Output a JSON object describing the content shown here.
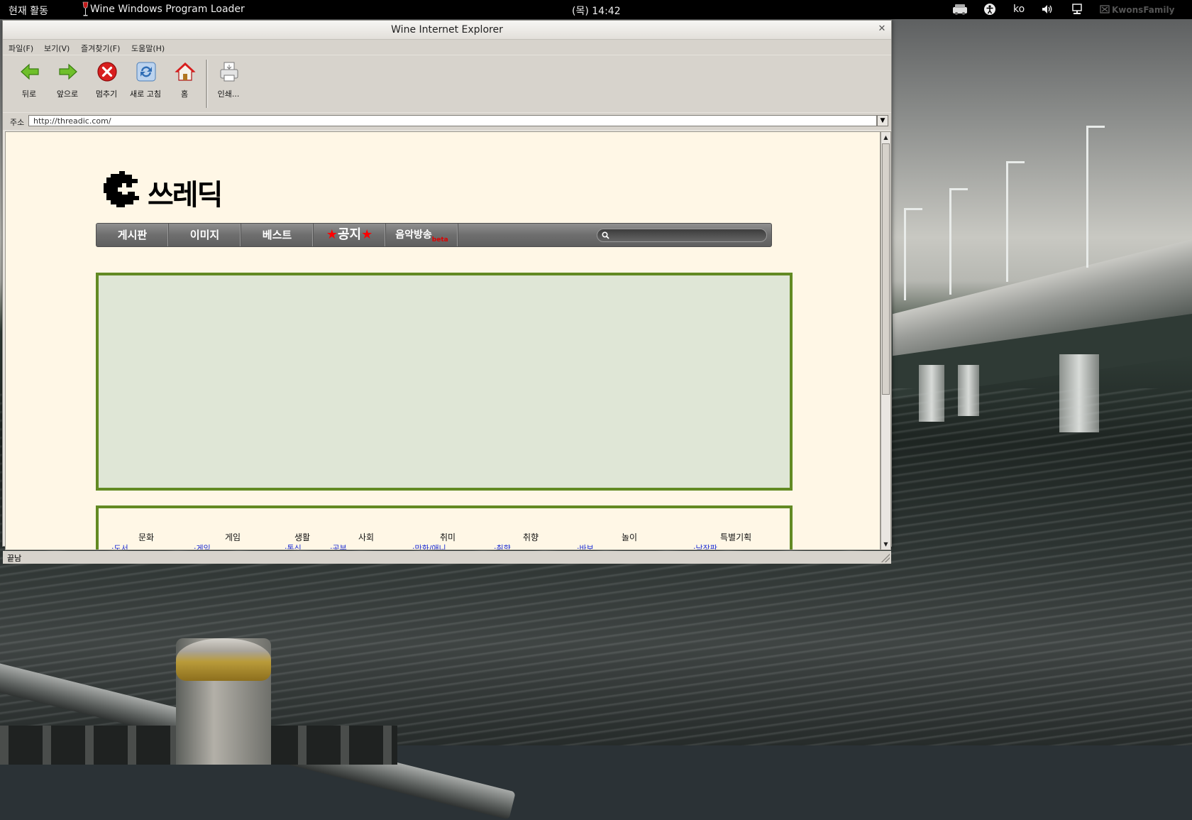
{
  "panel": {
    "activities": "현재 활동",
    "app_name": "Wine Windows Program Loader",
    "clock": "(목) 14:42",
    "lang": "ko",
    "user": "KwonsFamily"
  },
  "window": {
    "title": "Wine Internet Explorer",
    "close_glyph": "✕"
  },
  "menu": {
    "items": [
      "파일(F)",
      "보기(V)",
      "즐겨찾기(F)",
      "도움말(H)"
    ]
  },
  "toolbar": {
    "buttons": [
      {
        "label": "뒤로",
        "icon": "back-arrow-icon"
      },
      {
        "label": "앞으로",
        "icon": "forward-arrow-icon"
      },
      {
        "label": "멈추기",
        "icon": "stop-icon"
      },
      {
        "label": "새로 고침",
        "icon": "refresh-icon"
      },
      {
        "label": "홈",
        "icon": "home-icon"
      },
      {
        "label": "인쇄...",
        "icon": "print-icon"
      }
    ]
  },
  "address": {
    "label": "주소",
    "url": "http://threadic.com/"
  },
  "status": {
    "text": "끝남"
  },
  "page": {
    "logo_text": "쓰레딕",
    "nav": [
      {
        "label": "게시판"
      },
      {
        "label": "이미지"
      },
      {
        "label": "베스트"
      },
      {
        "label": "공지",
        "stars": "★"
      },
      {
        "label": "음악방송",
        "badge": "beta"
      }
    ],
    "categories": [
      {
        "title": "문화",
        "first": "·도서"
      },
      {
        "title": "게임",
        "first": "·게임"
      },
      {
        "title": "생활",
        "first": "·통신"
      },
      {
        "title": "사회",
        "first": "·공부"
      },
      {
        "title": "취미",
        "first": "·만화/애니"
      },
      {
        "title": "취향",
        "first": "·취향"
      },
      {
        "title": "놀이",
        "first": "·바보"
      },
      {
        "title": "특별기획",
        "first": "·낙장판"
      }
    ]
  },
  "colors": {
    "page_bg": "#fff7e6",
    "ad_border": "#628a23",
    "ad_bg": "#dfe6d6",
    "link": "#1b2cd3"
  }
}
